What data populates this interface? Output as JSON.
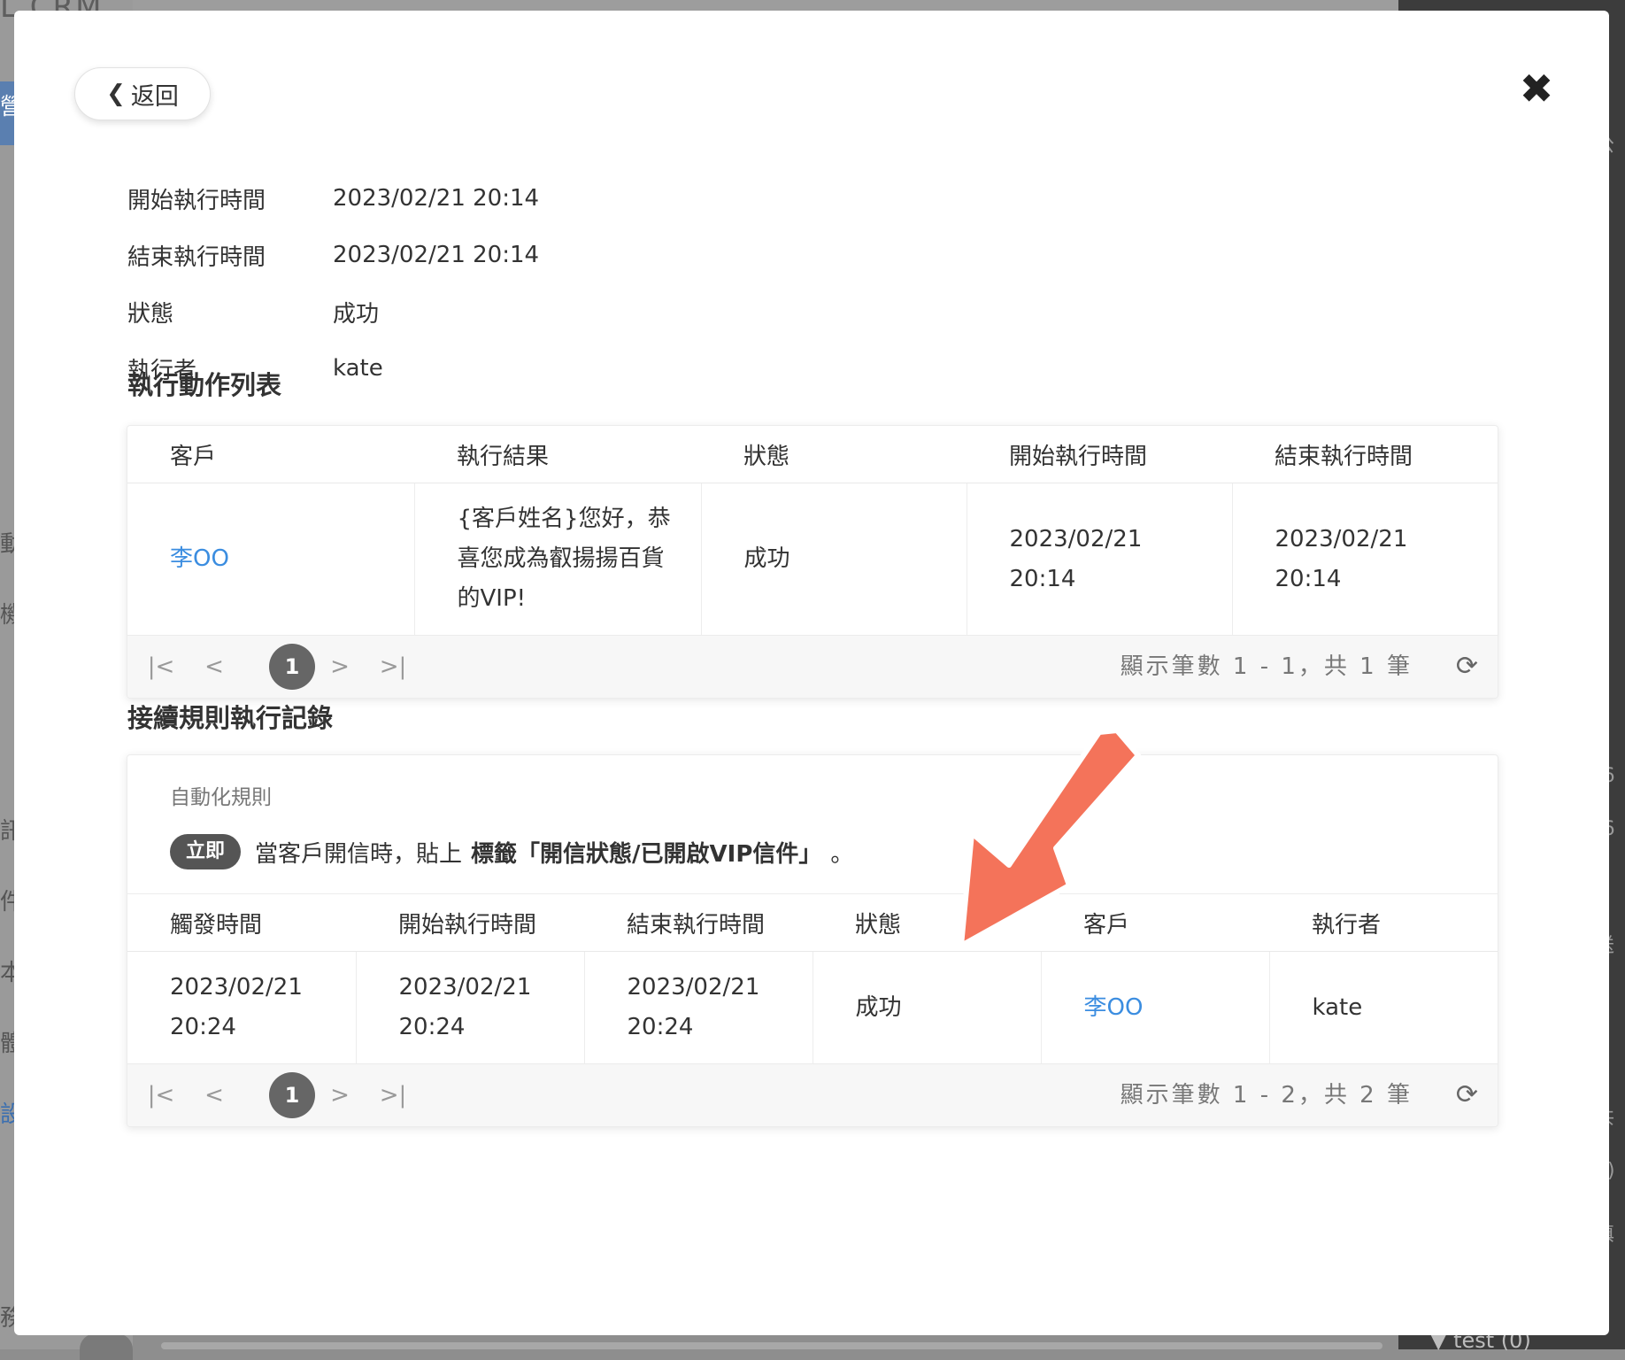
{
  "background": {
    "logo": "L CRM",
    "left_fragments": [
      "營",
      "動",
      "機",
      "訊",
      "件",
      "本",
      "體",
      "設",
      "務"
    ],
    "right_fragments": [
      "公",
      "3",
      "(6",
      "(6",
      "送",
      "(",
      "共",
      "0)",
      "填"
    ],
    "bottom_right": "▼ test (0)"
  },
  "modal": {
    "back_label": "返回",
    "close_icon": "✖",
    "info": {
      "start_label": "開始執行時間",
      "start_value": "2023/02/21 20:14",
      "end_label": "結束執行時間",
      "end_value": "2023/02/21 20:14",
      "status_label": "狀態",
      "status_value": "成功",
      "executor_label": "執行者",
      "executor_value": "kate"
    },
    "actions": {
      "title": "執行動作列表",
      "headers": [
        "客戶",
        "執行結果",
        "狀態",
        "開始執行時間",
        "結束執行時間"
      ],
      "row": {
        "customer": "李OO",
        "result": "{客戶姓名}您好，恭喜您成為叡揚揚百貨的VIP!",
        "status": "成功",
        "start": "2023/02/21 20:14",
        "end": "2023/02/21 20:14"
      },
      "pager": {
        "first": "|<",
        "prev": "<",
        "page": "1",
        "next": ">",
        "last": ">|",
        "info": "顯示筆數 1 - 1，共 1 筆",
        "refresh_icon": "⟳"
      }
    },
    "followup": {
      "title": "接續規則執行記錄",
      "rule_label": "自動化規則",
      "badge": "立即",
      "rule_text_1": "當客戶開信時，貼上",
      "rule_text_bold": "標籤「開信狀態/已開啟VIP信件」",
      "rule_text_end": "。",
      "headers": [
        "觸發時間",
        "開始執行時間",
        "結束執行時間",
        "狀態",
        "客戶",
        "執行者"
      ],
      "row": {
        "trigger": "2023/02/21 20:24",
        "start": "2023/02/21 20:24",
        "end": "2023/02/21 20:24",
        "status": "成功",
        "customer": "李OO",
        "executor": "kate"
      },
      "pager": {
        "first": "|<",
        "prev": "<",
        "page": "1",
        "next": ">",
        "last": ">|",
        "info": "顯示筆數 1 - 2，共 2 筆",
        "refresh_icon": "⟳"
      }
    },
    "annotation": {
      "arrow_color": "#f4735a",
      "arrow_icon": "arrow-down-left-icon"
    }
  }
}
